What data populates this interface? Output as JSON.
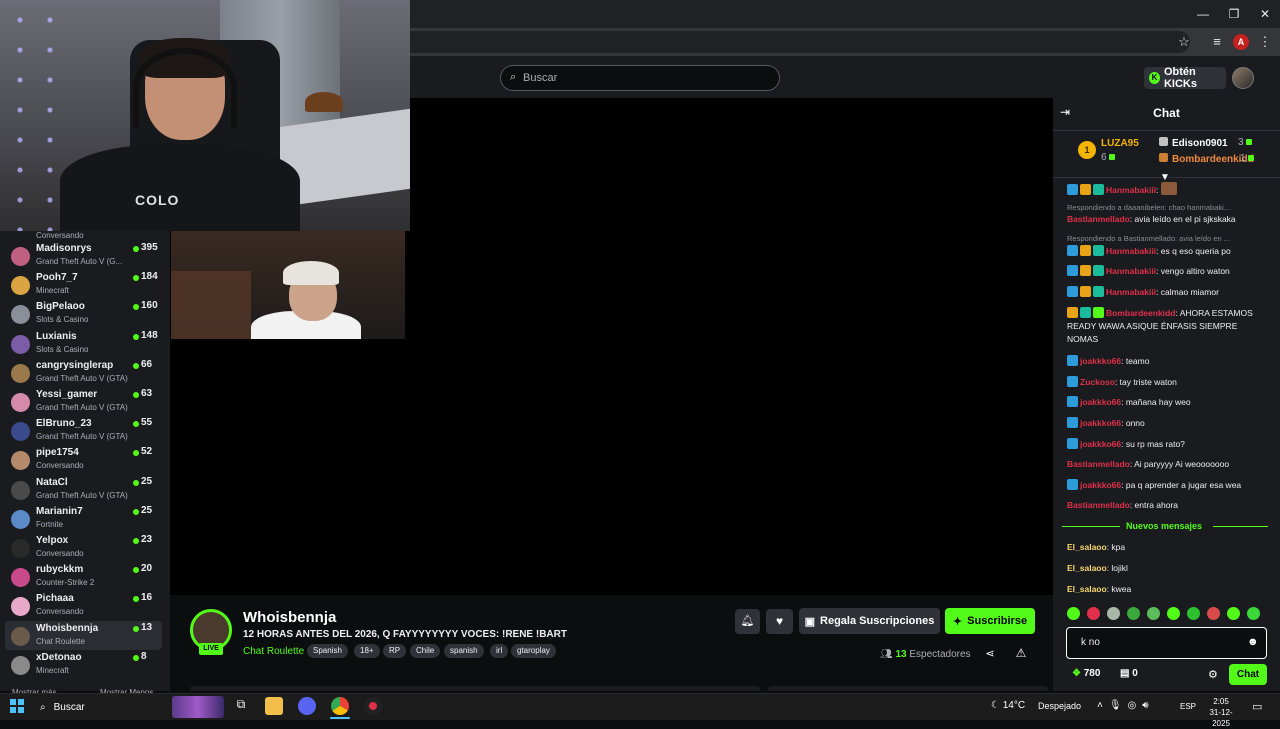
{
  "browser": {
    "window_controls": [
      "—",
      "❐",
      "✕"
    ],
    "icons": [
      "star-icon",
      "media-icon",
      "profile-icon",
      "menu-icon"
    ],
    "profile_initial": "A"
  },
  "header": {
    "search_placeholder": "Buscar",
    "kicks_button": "Obtén KICKs"
  },
  "webcam": {
    "shirt_text": "COLO"
  },
  "sidebar": {
    "top_partial_category": "Conversando",
    "items": [
      {
        "name": "Madisonrys",
        "category": "Grand Theft Auto V (G...",
        "viewers": "395",
        "color": "#c06080"
      },
      {
        "name": "Pooh7_7",
        "category": "Minecraft",
        "viewers": "184",
        "color": "#d9a441"
      },
      {
        "name": "BigPelaoo",
        "category": "Slots & Casino",
        "viewers": "160",
        "color": "#8a8f9a"
      },
      {
        "name": "Luxianis",
        "category": "Slots & Casino",
        "viewers": "148",
        "color": "#7a5ca8"
      },
      {
        "name": "cangrysinglerap",
        "category": "Grand Theft Auto V (GTA)",
        "viewers": "66",
        "color": "#9a7a4a"
      },
      {
        "name": "Yessi_gamer",
        "category": "Grand Theft Auto V (GTA)",
        "viewers": "63",
        "color": "#d48aa8"
      },
      {
        "name": "ElBruno_23",
        "category": "Grand Theft Auto V (GTA)",
        "viewers": "55",
        "color": "#3a4a8a"
      },
      {
        "name": "pipe1754",
        "category": "Conversando",
        "viewers": "52",
        "color": "#b58a6a"
      },
      {
        "name": "NataCl",
        "category": "Grand Theft Auto V (GTA)",
        "viewers": "25",
        "color": "#4a4a4a"
      },
      {
        "name": "Marianin7",
        "category": "Fortnite",
        "viewers": "25",
        "color": "#5a8ac8"
      },
      {
        "name": "Yelpox",
        "category": "Conversando",
        "viewers": "23",
        "color": "#2a2a2a"
      },
      {
        "name": "rubyckkm",
        "category": "Counter-Strike 2",
        "viewers": "20",
        "color": "#c84a8a"
      },
      {
        "name": "Pichaaa",
        "category": "Conversando",
        "viewers": "16",
        "color": "#e8a8c8"
      },
      {
        "name": "Whoisbennja",
        "category": "Chat Roulette",
        "viewers": "13",
        "color": "#6a5a4a",
        "active": true
      },
      {
        "name": "xDetonao",
        "category": "Minecraft",
        "viewers": "8",
        "color": "#8a8a8a"
      }
    ],
    "show_more": "Mostrar más",
    "show_less": "Mostrar Menos"
  },
  "stream": {
    "live_label": "LIVE",
    "streamer": "Whoisbennja",
    "title": "12 HORAS ANTES DEL 2026, Q FAYYYYYYYY VOCES: !RENE !BART",
    "category": "Chat Roulette",
    "tags": [
      "Spanish",
      "18+",
      "RP",
      "Chile",
      "spanish",
      "irl",
      "gtaroplay"
    ],
    "gift_button": "Regala Suscripciones",
    "subscribe_button": "Suscribirse",
    "viewer_count": "13",
    "viewer_label": "Espectadores"
  },
  "chat": {
    "title": "Chat",
    "leaderboard": {
      "first_rank": "1",
      "first_name": "LUZA95",
      "first_count": "6",
      "second_name": "Edison0901",
      "second_count": "3",
      "third_name": "Bombardeenkidd",
      "third_count": "1"
    },
    "messages": {
      "m1_user": "Hanmabakiii",
      "m1_text": ":",
      "r1": "Respondiendo a daaanibelen: chao hanmabaki...",
      "m2_user": "Bastianmellado",
      "m2_text": ": avia leído en el pi sjkskaka",
      "r2": "Respondiendo a Bastianmellado: avia leído en ...",
      "m3_user": "Hanmabakiii",
      "m3_text": ": es q eso queria po",
      "m4_user": "Hanmabakiii",
      "m4_text": ": vengo altiro waton",
      "m5_user": "Hanmabakiii",
      "m5_text": ": calmao miamor",
      "m6_user": "Bombardeenkidd",
      "m6_text": ": AHORA ESTAMOS READY WAWA ASIQUE ÉNFASIS SIEMPRE NOMAS",
      "m7_user": "joakkko66",
      "m7_text": ": teamo",
      "m8_user": "Zuckoso",
      "m8_text": ": tay triste waton",
      "m9_user": "joakkko66",
      "m9_text": ": mañana hay weo",
      "m10_user": "joakkko66",
      "m10_text": ": onno",
      "m11_user": "joakkko66",
      "m11_text": ": su rp mas rato?",
      "m12_user": "Bastianmellado",
      "m12_text": ": Ai paryyyy Ai weooooooo",
      "m13_user": "joakkko66",
      "m13_text": ": pa q aprender a jugar esa wea",
      "m14_user": "Bastianmellado",
      "m14_text": ": entra ahora",
      "new_label": "Nuevos mensajes",
      "m15_user": "El_salaoo",
      "m15_text": ": kpa",
      "m16_user": "El_salaoo",
      "m16_text": ": lojikl",
      "m17_user": "El_salaoo",
      "m17_text": ": kwea"
    },
    "input_value": "k no",
    "kicks_balance": "780",
    "gift_balance": "0",
    "send_button": "Chat"
  },
  "taskbar": {
    "search_label": "Buscar",
    "weather_temp": "14°C",
    "weather_desc": "Despejado",
    "language": "ESP",
    "time": "2:05",
    "date": "31-12-2025"
  },
  "colors": {
    "accent": "#53fc18",
    "background": "#0b0e0f",
    "panel": "#191b1f",
    "username_red": "#e0304a",
    "username_blue": "#4aa3ff",
    "username_gold": "#f5b400"
  }
}
